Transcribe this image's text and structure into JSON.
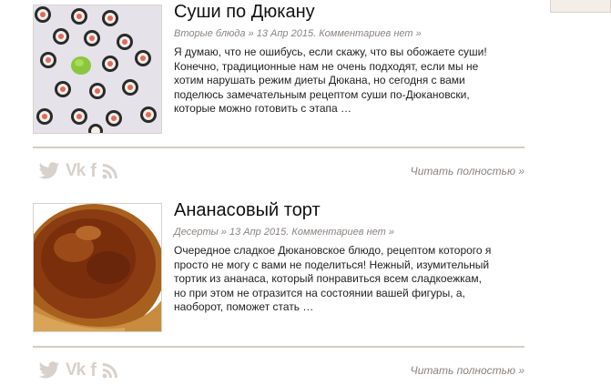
{
  "posts": [
    {
      "title": "Суши по Дюкану",
      "category": "Вторые блюда",
      "meta_sep_1": " » ",
      "date": "13 Апр 2015",
      "meta_sep_2": ". ",
      "comments": "Комментариев нет »",
      "excerpt_lines": [
        "Я думаю, что не ошибусь, если скажу, что вы обожаете суши!",
        "Конечно, традиционные нам не очень подходят, если мы не",
        "хотим нарушать режим диеты Дюкана, но сегодня с вами",
        "поделюсь замечательным рецептом суши по-Дюкановски,",
        "которые можно готовить с этапа …"
      ],
      "read_more": "Читать полностью »"
    },
    {
      "title": "Ананасовый торт",
      "category": "Десерты",
      "meta_sep_1": " » ",
      "date": "13 Апр 2015",
      "meta_sep_2": ". ",
      "comments": "Комментариев нет »",
      "excerpt_lines": [
        "Очередное сладкое Дюкановское блюдо, рецептом которого я",
        "просто не могу с вами не поделиться! Нежный, изумительный",
        "тортик из ананаса, который понравиться всем сладкоежкам,",
        "но при этом не отразится на состоянии вашей фигуры, а,",
        "наоборот, поможет стать …"
      ],
      "read_more": "Читать полностью »"
    }
  ],
  "share": {
    "icons": [
      "twitter-icon",
      "vk-icon",
      "facebook-icon",
      "rss-icon"
    ],
    "vk_text": "Vk",
    "fb_text": "f",
    "icon_color": "#d8d1cb"
  },
  "colors": {
    "divider": "#d6ccc4",
    "meta": "#8a8480",
    "title": "#111111"
  }
}
